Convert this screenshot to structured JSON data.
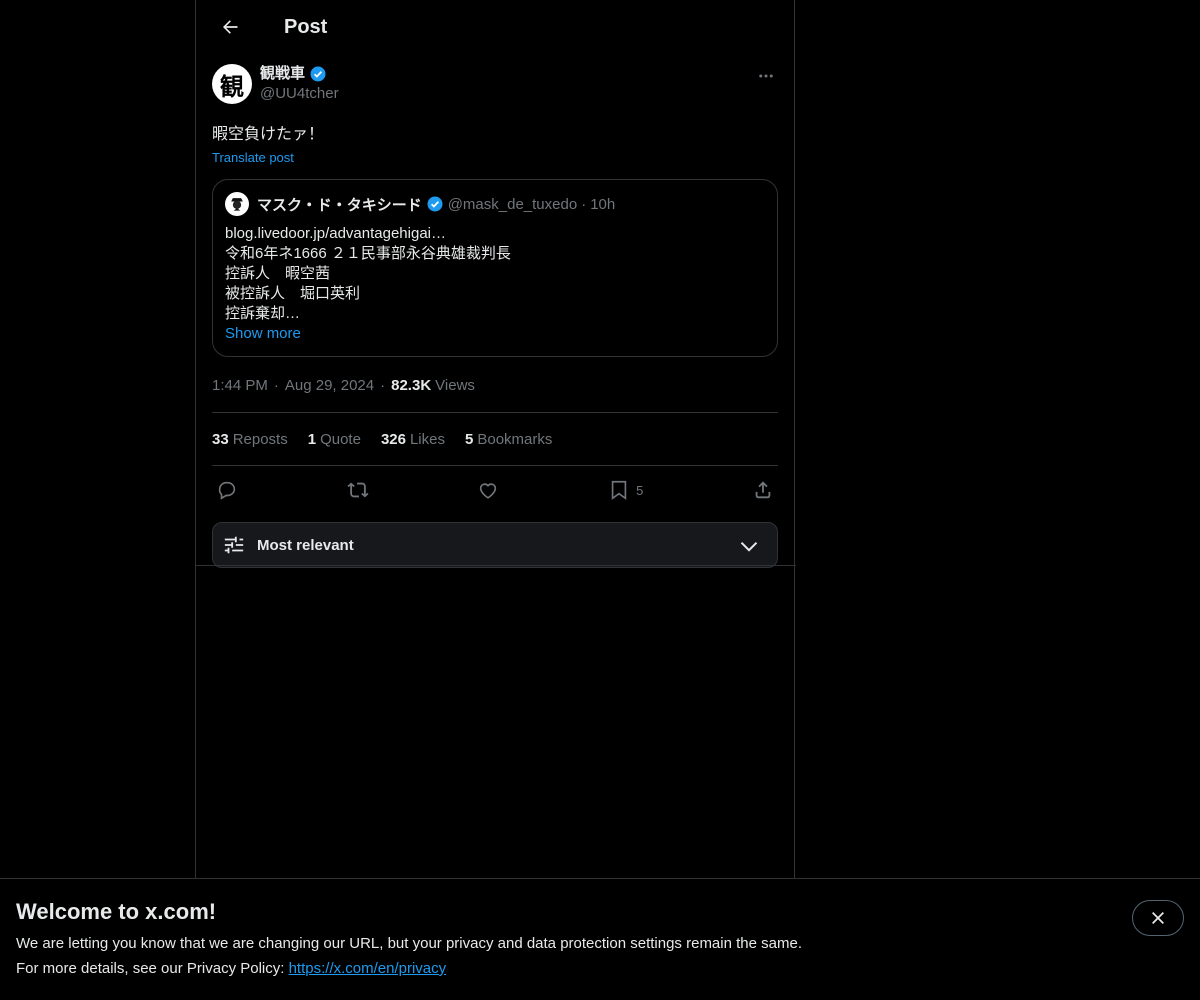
{
  "header": {
    "title": "Post"
  },
  "post": {
    "author_name": "観戦車",
    "handle": "@UU4tcher",
    "avatar_char": "観",
    "text": "暇空負けたァ！",
    "translate_label": "Translate post",
    "timestamp": "1:44 PM",
    "date": "Aug 29, 2024",
    "views_count": "82.3K",
    "views_label": "Views"
  },
  "quote": {
    "author_name": "マスク・ド・タキシード",
    "handle": "@mask_de_tuxedo",
    "time": "10h",
    "lines": [
      "blog.livedoor.jp/advantagehigai…",
      "令和6年ネ1666 ２１民事部永谷典雄裁判長",
      "控訴人　暇空茜",
      "被控訴人　堀口英利",
      "控訴棄却…"
    ],
    "show_more": "Show more"
  },
  "stats": {
    "reposts_count": "33",
    "reposts_label": "Reposts",
    "quote_count": "1",
    "quote_label": "Quote",
    "likes_count": "326",
    "likes_label": "Likes",
    "bookmarks_count": "5",
    "bookmarks_label": "Bookmarks"
  },
  "actions": {
    "bookmark_count": "5"
  },
  "sort": {
    "label": "Most relevant"
  },
  "banner": {
    "title": "Welcome to x.com!",
    "line1": "We are letting you know that we are changing our URL, but your privacy and data protection settings remain the same.",
    "line2_prefix": "For more details, see our Privacy Policy: ",
    "link": "https://x.com/en/privacy"
  },
  "colors": {
    "accent": "#1d9bf0",
    "verified": "#1d9bf0",
    "muted": "#71767b",
    "border": "#2f3336"
  },
  "icons": [
    "back-arrow-icon",
    "verified-icon",
    "more-icon",
    "reply-icon",
    "repost-icon",
    "like-icon",
    "bookmark-icon",
    "share-icon",
    "sliders-icon",
    "chevron-down-icon",
    "close-icon"
  ]
}
